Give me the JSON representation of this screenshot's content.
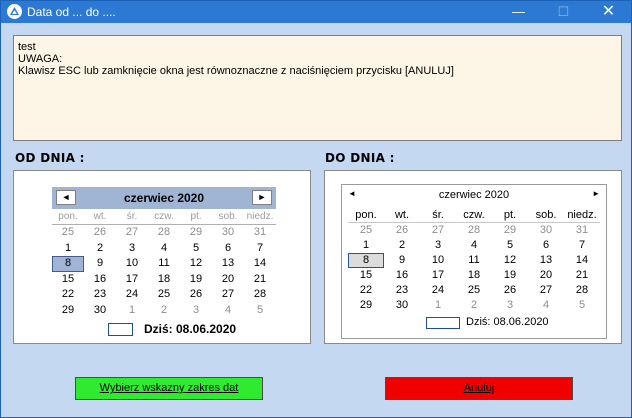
{
  "window": {
    "title": "Data od ... do ....",
    "minimize_glyph": "—",
    "maximize_glyph": "☐",
    "close_glyph": "✕"
  },
  "message": {
    "line1": "test",
    "line2": "",
    "line3": "UWAGA:",
    "line4": "Klawisz ESC lub zamknięcie okna jest równoznaczne z naciśnięciem przycisku [ANULUJ]"
  },
  "from": {
    "label": "OD DNIA :",
    "month": "czerwiec 2020",
    "prev": "◄",
    "next": "►",
    "dows": [
      "pon.",
      "wt.",
      "śr.",
      "czw.",
      "pt.",
      "sob.",
      "niedz."
    ],
    "days": [
      "25",
      "26",
      "27",
      "28",
      "29",
      "30",
      "31",
      "1",
      "2",
      "3",
      "4",
      "5",
      "6",
      "7",
      "8",
      "9",
      "10",
      "11",
      "12",
      "13",
      "14",
      "15",
      "16",
      "17",
      "18",
      "19",
      "20",
      "21",
      "22",
      "23",
      "24",
      "25",
      "26",
      "27",
      "28",
      "29",
      "30",
      "1",
      "2",
      "3",
      "4",
      "5"
    ],
    "today": "Dziś: 08.06.2020"
  },
  "to": {
    "label": "DO DNIA :",
    "month": "czerwiec 2020",
    "prev": "◄",
    "next": "►",
    "dows": [
      "pon.",
      "wt.",
      "śr.",
      "czw.",
      "pt.",
      "sob.",
      "niedz."
    ],
    "days": [
      "25",
      "26",
      "27",
      "28",
      "29",
      "30",
      "31",
      "1",
      "2",
      "3",
      "4",
      "5",
      "6",
      "7",
      "8",
      "9",
      "10",
      "11",
      "12",
      "13",
      "14",
      "15",
      "16",
      "17",
      "18",
      "19",
      "20",
      "21",
      "22",
      "23",
      "24",
      "25",
      "26",
      "27",
      "28",
      "29",
      "30",
      "1",
      "2",
      "3",
      "4",
      "5"
    ],
    "today": "Dziś: 08.06.2020"
  },
  "buttons": {
    "ok_label": "Wybierz wskazny zakres dat",
    "cancel_label": "Anuluj"
  },
  "colors": {
    "ok_button": "#2fea2f",
    "cancel_button": "#f10000",
    "titlebar": "#2b79d2"
  }
}
